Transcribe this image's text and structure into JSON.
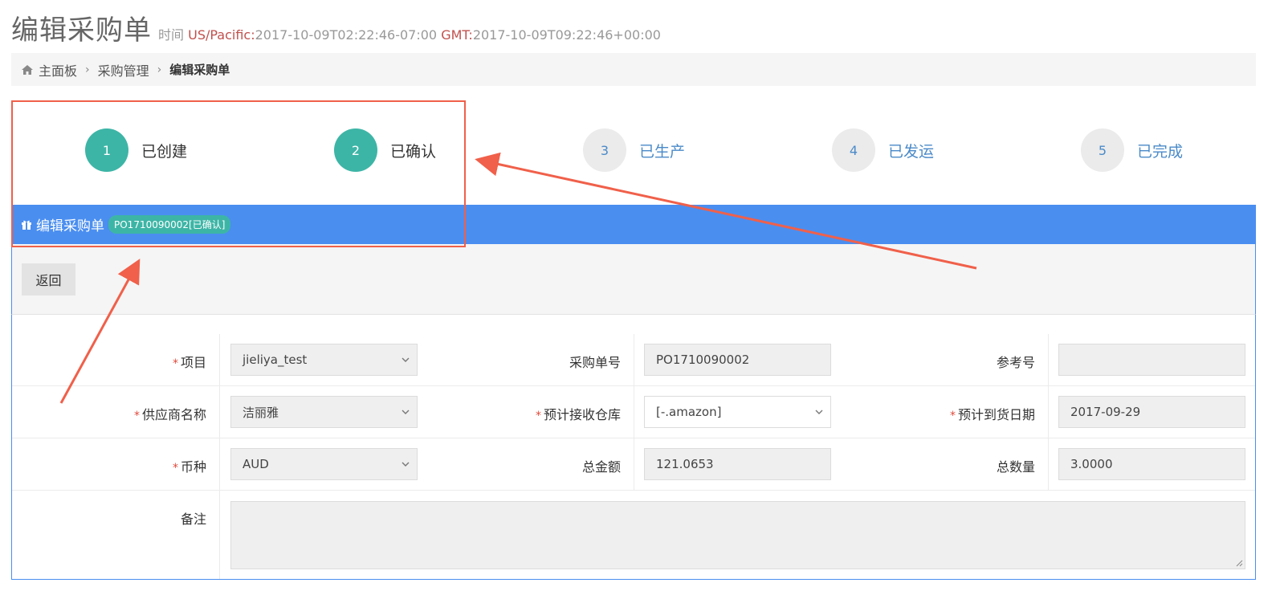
{
  "header": {
    "title": "编辑采购单",
    "time_prefix": "时间",
    "tz1_label": "US/Pacific:",
    "tz1_value": "2017-10-09T02:22:46-07:00",
    "tz2_label": "GMT:",
    "tz2_value": "2017-10-09T09:22:46+00:00"
  },
  "breadcrumb": {
    "home": "主面板",
    "level2": "采购管理",
    "current": "编辑采购单"
  },
  "steps": [
    {
      "num": "1",
      "label": "已创建",
      "state": "done"
    },
    {
      "num": "2",
      "label": "已确认",
      "state": "done"
    },
    {
      "num": "3",
      "label": "已生产",
      "state": "todo"
    },
    {
      "num": "4",
      "label": "已发运",
      "state": "todo"
    },
    {
      "num": "5",
      "label": "已完成",
      "state": "todo"
    }
  ],
  "panel": {
    "title": "编辑采购单",
    "badge": "PO1710090002[已确认]"
  },
  "toolbar": {
    "back_label": "返回"
  },
  "form": {
    "required_mark": "*",
    "project": {
      "label": "项目",
      "value": "jieliya_test"
    },
    "po_number": {
      "label": "采购单号",
      "value": "PO1710090002"
    },
    "reference": {
      "label": "参考号",
      "value": ""
    },
    "supplier": {
      "label": "供应商名称",
      "value": "洁丽雅"
    },
    "warehouse": {
      "label": "预计接收仓库",
      "value": "[-.amazon]"
    },
    "arrival_date": {
      "label": "预计到货日期",
      "value": "2017-09-29"
    },
    "currency": {
      "label": "币种",
      "value": "AUD"
    },
    "total_amount": {
      "label": "总金额",
      "value": "121.0653"
    },
    "total_qty": {
      "label": "总数量",
      "value": "3.0000"
    },
    "remark": {
      "label": "备注",
      "value": ""
    }
  },
  "colors": {
    "primary": "#4a8ef0",
    "step_done": "#3db5a6",
    "annotation": "#f0604a",
    "required": "#e04a3c"
  }
}
